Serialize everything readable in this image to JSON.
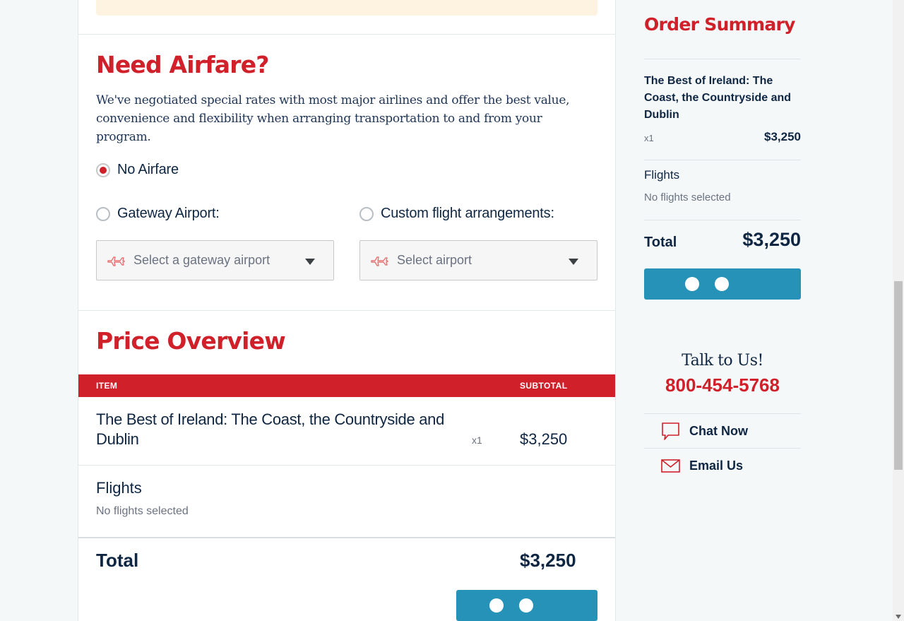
{
  "airfare": {
    "heading": "Need Airfare?",
    "intro": "We've negotiated special rates with most major airlines and offer the best value, convenience and flexibility when arranging transportation to and from your program.",
    "options": {
      "no_airfare": "No Airfare",
      "gateway": "Gateway Airport:",
      "custom": "Custom flight arrangements:"
    },
    "selected_option": "no_airfare",
    "gateway_select_placeholder": "Select a gateway airport",
    "custom_select_placeholder": "Select airport"
  },
  "price_overview": {
    "heading": "Price Overview",
    "columns": {
      "item": "ITEM",
      "subtotal": "SUBTOTAL"
    },
    "item": {
      "title": "The Best of Ireland: The Coast, the Countryside and Dublin",
      "qty": "x1",
      "price": "$3,250"
    },
    "flights": {
      "title": "Flights",
      "status": "No flights selected"
    },
    "total": {
      "label": "Total",
      "value": "$3,250"
    }
  },
  "order_summary": {
    "heading": "Order Summary",
    "trip_title": "The Best of Ireland: The Coast, the Countryside and Dublin",
    "qty": "x1",
    "price": "$3,250",
    "flights_title": "Flights",
    "flights_status": "No flights selected",
    "total_label": "Total",
    "total_value": "$3,250"
  },
  "contact": {
    "talk": "Talk to Us!",
    "phone": "800-454-5768",
    "chat": "Chat Now",
    "email": "Email Us"
  },
  "icons": {
    "plane": "plane-icon",
    "chat": "chat-bubble-icon",
    "email": "envelope-icon",
    "caret": "caret-down-icon"
  },
  "colors": {
    "brand_red": "#d0202a",
    "button_blue": "#2692b7",
    "navy_text": "#0f2643",
    "notice_bg": "#fdf3e0"
  }
}
